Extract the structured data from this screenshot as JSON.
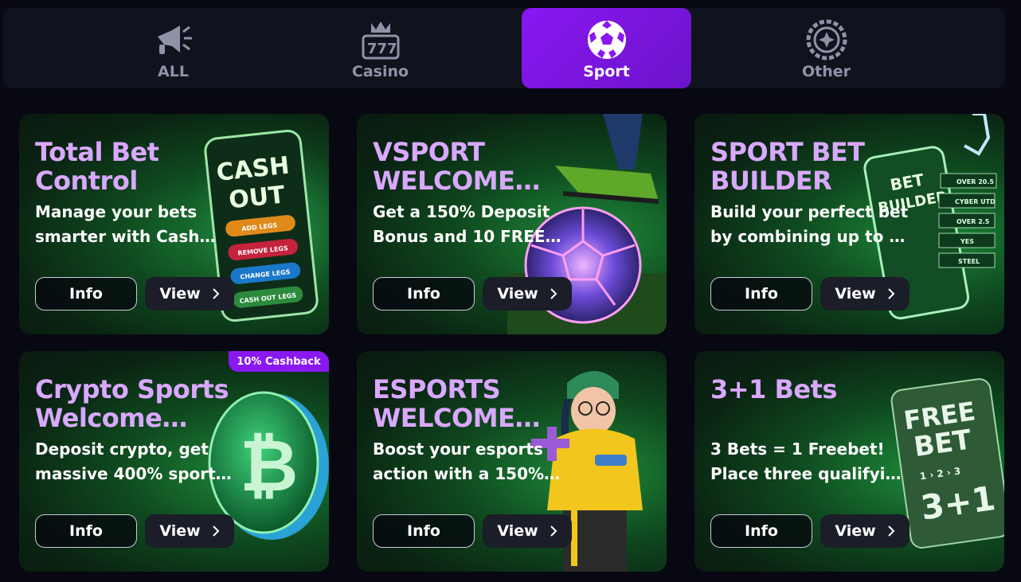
{
  "tabs": [
    {
      "label": "ALL",
      "icon": "megaphone-icon",
      "active": false
    },
    {
      "label": "Casino",
      "icon": "slot-777-icon",
      "active": false
    },
    {
      "label": "Sport",
      "icon": "soccer-ball-icon",
      "active": true
    },
    {
      "label": "Other",
      "icon": "roulette-icon",
      "active": false
    }
  ],
  "cards": [
    {
      "title": "Total Bet Control",
      "desc": "Manage your bets smarter with Cash…",
      "info": "Info",
      "view": "View",
      "art": "cash-out-phone",
      "art_text": {
        "line1": "CASH",
        "line2": "OUT",
        "b1": "ADD LEGS",
        "b2": "REMOVE LEGS",
        "b3": "CHANGE LEGS",
        "b4": "CASH OUT LEGS"
      }
    },
    {
      "title": "VSPORT WELCOME…",
      "desc": "Get a 150% Deposit Bonus and 10 FREE…",
      "info": "Info",
      "view": "View",
      "art": "neon-football"
    },
    {
      "title": "SPORT BET BUILDER",
      "desc": "Build your perfect bet by combining up to …",
      "info": "Info",
      "view": "View",
      "art": "bet-builder-phone",
      "art_text": {
        "line1": "BET",
        "line2": "BUILDER",
        "t1": "OVER 20.5",
        "t2": "CYBER UTD",
        "t3": "OVER 2.5",
        "t4": "YES",
        "t5": "STEEL"
      }
    },
    {
      "title": "Crypto Sports Welcome…",
      "desc": "Deposit crypto, get massive 400% sport…",
      "info": "Info",
      "view": "View",
      "art": "bitcoin-coin",
      "badge": "10% Cashback"
    },
    {
      "title": "ESPORTS WELCOME…",
      "desc": "Boost your esports action with a 150%…",
      "info": "Info",
      "view": "View",
      "art": "gamer-character"
    },
    {
      "title": "3+1 Bets",
      "desc": "3 Bets = 1 Freebet! Place three qualifyi…",
      "info": "Info",
      "view": "View",
      "art": "freebet-card",
      "art_text": {
        "line1": "FREE",
        "line2": "BET",
        "steps": "1 › 2 › 3",
        "big": "3+1"
      }
    }
  ],
  "colors": {
    "accent": "#8a16f2",
    "title": "#d9a8ff",
    "card_green": "#1e8a3a"
  }
}
